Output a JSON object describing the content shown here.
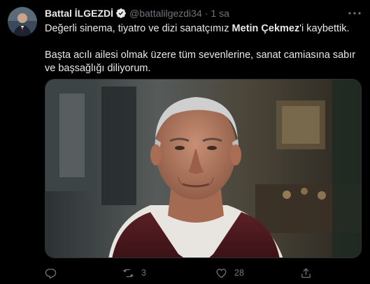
{
  "author": {
    "name": "Battal İLGEZDİ",
    "handle": "@battalilgezdi34",
    "separator": "·",
    "time": "1 sa"
  },
  "tweet": {
    "line1_before": "Değerli sinema, tiyatro ve dizi sanatçımız ",
    "line1_bold": "Metin Çekmez",
    "line1_after": "'i kaybettik.",
    "line2": "Başta acılı ailesi olmak üzere tüm sevenlerine, sanat camiasına sabır ve başsağlığı diliyorum."
  },
  "actions": {
    "reply_count": "",
    "retweet_count": "3",
    "like_count": "28"
  },
  "colors": {
    "background": "#000000",
    "text": "#e7e9ea",
    "muted": "#71767b",
    "verified": "#1d9bf0"
  },
  "icons": {
    "verified": "verified-badge-icon",
    "more": "more-icon",
    "reply": "reply-icon",
    "retweet": "retweet-icon",
    "like": "like-icon",
    "share": "share-icon"
  }
}
